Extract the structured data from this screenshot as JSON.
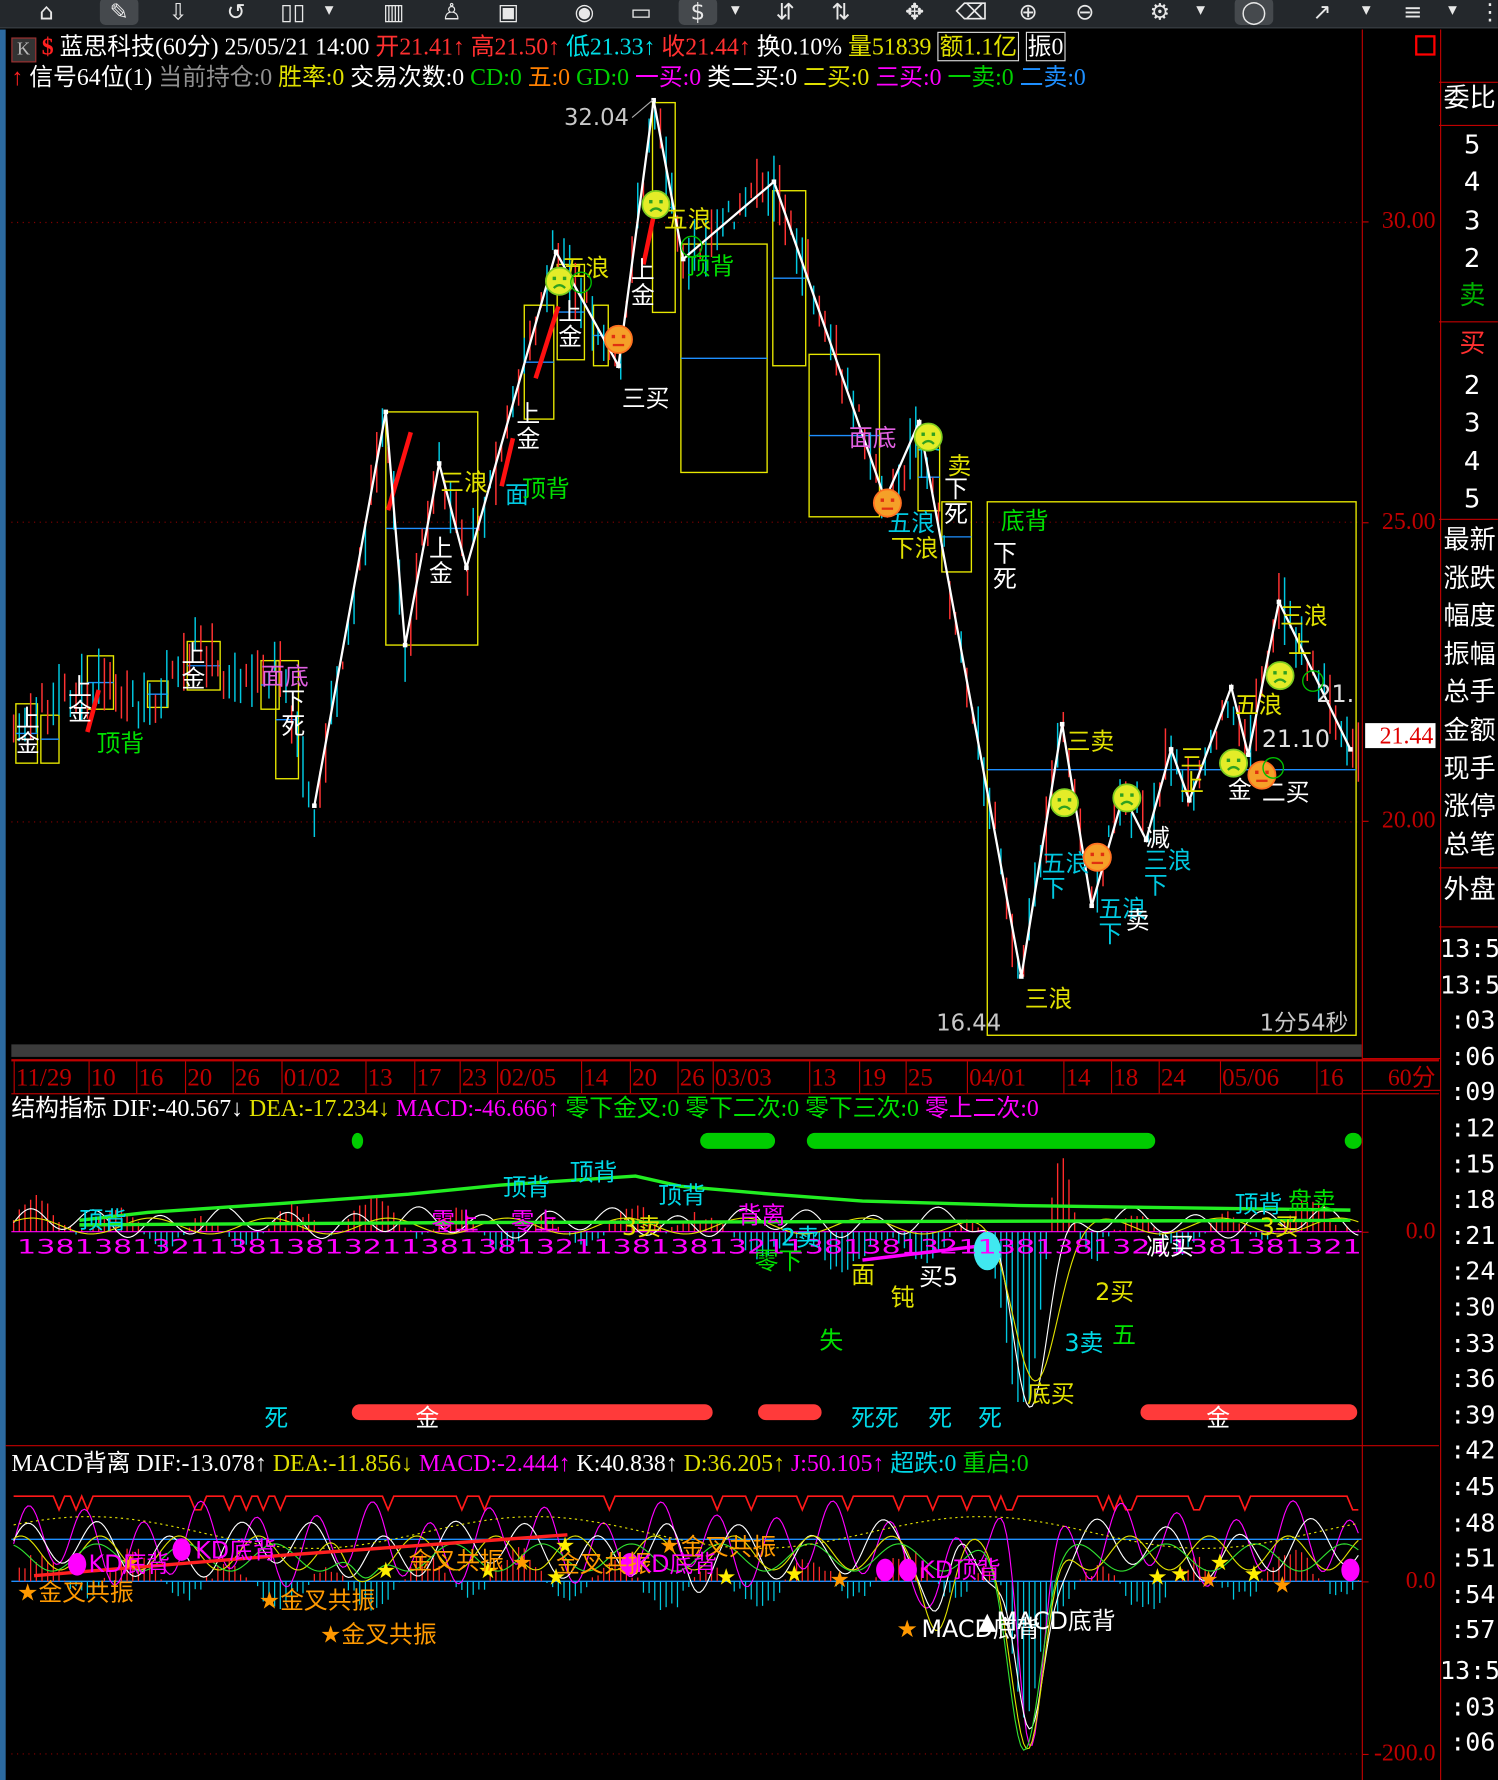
{
  "toolbar": {
    "icons": [
      "home-icon",
      "draw-pen-icon",
      "download-icon",
      "refresh-icon",
      "layout-icon",
      "indicator-icon",
      "alert-bell-icon",
      "screenshot-icon",
      "play-icon",
      "window-icon",
      "dollar-icon",
      "sort-asc-icon",
      "sort-desc-icon",
      "move-icon",
      "eraser-icon",
      "zoom-in-icon",
      "zoom-out-icon",
      "settings-icon",
      "lock-icon",
      "line-tool-icon",
      "percent-icon",
      "more-icon"
    ]
  },
  "header": {
    "k_label": "K",
    "stock": "蓝思科技(60分) 25/05/21 14:00",
    "open": "开21.41",
    "high": "高21.50",
    "low": "低21.33",
    "close": "收21.44",
    "turnover": "换0.10%",
    "volume": "量51839",
    "amount": "额1.1亿",
    "amplitude": "振0",
    "arrow_up": "↑",
    "row2": {
      "signal": "信号64位(1)",
      "position": "当前持仓:0",
      "winrate": "胜率:0",
      "trades": "交易次数:0",
      "cd": "CD:0",
      "wu": "五:0",
      "gd": "GD:0",
      "buy1": "一买:0",
      "class_buy2": "类二买:0",
      "buy2": "二买:0",
      "buy3": "三买:0",
      "sell1": "一卖:0",
      "sell2": "二卖:0"
    }
  },
  "price_axis": {
    "labels": [
      "30.00",
      "25.00",
      "20.00"
    ],
    "current_price": "21.44",
    "ind1_zero": "0.0",
    "ind2_zero": "0.0",
    "ind2_low": "-200.0"
  },
  "date_axis": [
    "11/29",
    "10",
    "16",
    "20",
    "26",
    "01/02",
    "13",
    "17",
    "23",
    "02/05",
    "14",
    "20",
    "26",
    "03/03",
    "13",
    "19",
    "25",
    "04/01",
    "14",
    "18",
    "24",
    "05/06",
    "16"
  ],
  "period": "60分",
  "chart_data": {
    "type": "candlestick",
    "title": "蓝思科技(60分)",
    "ylim": [
      16.44,
      32.04
    ],
    "yticks": [
      30,
      25,
      20
    ],
    "high_label": "32.04",
    "low_label": "16.44",
    "countdown": "1分54秒",
    "price_path": [
      [
        0,
        21.4
      ],
      [
        13.6,
        22.35
      ],
      [
        23.6,
        21.97
      ],
      [
        30.6,
        22.92
      ],
      [
        39.6,
        22.35
      ],
      [
        47.6,
        22.35
      ],
      [
        53,
        20.27
      ],
      [
        65.6,
        26.84
      ],
      [
        69,
        22.95
      ],
      [
        75,
        25.98
      ],
      [
        79.8,
        24.24
      ],
      [
        95.6,
        29.51
      ],
      [
        106.6,
        27.61
      ],
      [
        112.8,
        32.04
      ],
      [
        118,
        29.39
      ],
      [
        134,
        30.68
      ],
      [
        153.6,
        25.38
      ],
      [
        159.6,
        26.67
      ],
      [
        177.6,
        17.42
      ],
      [
        184.8,
        21.63
      ],
      [
        190,
        18.6
      ],
      [
        195.6,
        20.45
      ],
      [
        199.6,
        19.7
      ],
      [
        204,
        21.21
      ],
      [
        207.2,
        20.36
      ],
      [
        214.6,
        22.25
      ],
      [
        217.6,
        21.12
      ],
      [
        223,
        23.67
      ],
      [
        235.6,
        21.21
      ]
    ],
    "structure_line_from": 6,
    "boxes": [
      [
        0.4,
        4.2,
        21.97,
        20.98
      ],
      [
        4.8,
        8,
        21.78,
        20.98
      ],
      [
        13,
        17.6,
        22.77,
        21.88
      ],
      [
        23.6,
        27.2,
        22.35,
        21.91
      ],
      [
        30.6,
        36.4,
        23.01,
        22.2
      ],
      [
        43.6,
        46.8,
        22.69,
        21.88
      ],
      [
        46.2,
        50.2,
        22.69,
        20.72
      ],
      [
        65.6,
        81.8,
        26.84,
        22.95
      ],
      [
        90,
        95.2,
        28.62,
        26.72
      ],
      [
        95.8,
        100.6,
        29.3,
        27.71
      ],
      [
        102.2,
        104.8,
        28.62,
        27.61
      ],
      [
        112.6,
        116.6,
        32.0,
        28.5
      ],
      [
        117.6,
        132.8,
        29.64,
        25.83
      ],
      [
        133.8,
        139.6,
        30.53,
        27.61
      ],
      [
        140.2,
        152.6,
        27.8,
        25.09
      ],
      [
        159.4,
        163.2,
        26.31,
        25.19
      ],
      [
        163.6,
        168.8,
        25.34,
        24.17
      ],
      [
        171.6,
        236.6,
        25.34,
        16.44,
        20.87
      ]
    ],
    "annotations": [
      {
        "t": "上\n金",
        "c": "#ffffff",
        "b": 0.4,
        "p": 21.59
      },
      {
        "t": "上\n金",
        "c": "#ffffff",
        "b": 9.6,
        "p": 22.12
      },
      {
        "t": "顶背",
        "c": "#00e000",
        "b": 14.6,
        "p": 21.17
      },
      {
        "t": "上\n金",
        "c": "#ffffff",
        "b": 29.6,
        "p": 22.67
      },
      {
        "t": "面底",
        "c": "#e060e0",
        "b": 43.6,
        "p": 22.29
      },
      {
        "t": "下\n死",
        "c": "#ffffff",
        "b": 47.2,
        "p": 21.88
      },
      {
        "t": "上\n金",
        "c": "#ffffff",
        "b": 73.2,
        "p": 24.43
      },
      {
        "t": "三浪",
        "c": "#e0e000",
        "b": 75.2,
        "p": 25.53
      },
      {
        "t": "面",
        "c": "#00c8e0",
        "b": 86.6,
        "p": 25.32
      },
      {
        "t": "顶背",
        "c": "#00e000",
        "b": 89.6,
        "p": 25.42
      },
      {
        "t": "上\n金",
        "c": "#ffffff",
        "b": 88.6,
        "p": 26.67
      },
      {
        "t": "上\n金",
        "c": "#ffffff",
        "b": 96,
        "p": 28.37
      },
      {
        "t": "五浪",
        "c": "#e0e000",
        "b": 96.6,
        "p": 29.11
      },
      {
        "t": "三买",
        "c": "#ffffff",
        "b": 107.2,
        "p": 26.93
      },
      {
        "t": "上\n金",
        "c": "#ffffff",
        "b": 108.8,
        "p": 29.07
      },
      {
        "t": "五浪",
        "c": "#e0e000",
        "b": 114.6,
        "p": 29.92
      },
      {
        "t": "顶背",
        "c": "#00e000",
        "b": 118.6,
        "p": 29.13
      },
      {
        "t": "面底",
        "c": "#e060e0",
        "b": 147.2,
        "p": 26.27
      },
      {
        "t": "类",
        "c": "#00c8e0",
        "b": 159.2,
        "p": 26.23
      },
      {
        "t": "卖",
        "c": "#e0e000",
        "b": 164.6,
        "p": 25.8
      },
      {
        "t": "下\n死",
        "c": "#ffffff",
        "b": 164,
        "p": 25.42
      },
      {
        "t": "五浪",
        "c": "#00c8e0",
        "b": 154,
        "p": 24.85
      },
      {
        "t": "下浪",
        "c": "#e0e000",
        "b": 154.6,
        "p": 24.43
      },
      {
        "t": "底背",
        "c": "#00e000",
        "b": 174,
        "p": 24.89
      },
      {
        "t": "下\n死",
        "c": "#ffffff",
        "b": 172.6,
        "p": 24.34
      },
      {
        "t": "三卖",
        "c": "#e0e000",
        "b": 185.6,
        "p": 21.21
      },
      {
        "t": "五浪\n下",
        "c": "#00c8e0",
        "b": 181.2,
        "p": 19.17
      },
      {
        "t": "五浪\n下",
        "c": "#00c8e0",
        "b": 191.2,
        "p": 18.41
      },
      {
        "t": "卖",
        "c": "#ffffff",
        "b": 196,
        "p": 18.22
      },
      {
        "t": "三浪",
        "c": "#e0e000",
        "b": 178.2,
        "p": 16.91
      },
      {
        "t": "减",
        "c": "#ffffff",
        "b": 199.6,
        "p": 19.6
      },
      {
        "t": "三浪\n下",
        "c": "#00c8e0",
        "b": 199.2,
        "p": 19.22
      },
      {
        "t": "三\n上",
        "c": "#e0e000",
        "b": 205.6,
        "p": 20.93
      },
      {
        "t": "五浪",
        "c": "#e0e000",
        "b": 215.2,
        "p": 21.82
      },
      {
        "t": "21.10",
        "c": "#e0e0e0",
        "b": 220,
        "p": 21.25
      },
      {
        "t": "21.",
        "c": "#e0e0e0",
        "b": 229.6,
        "p": 22.0
      },
      {
        "t": "二买",
        "c": "#ffffff",
        "b": 220,
        "p": 20.36
      },
      {
        "t": "金",
        "c": "#ffffff",
        "b": 214,
        "p": 20.4
      },
      {
        "t": "三浪",
        "c": "#e0e000",
        "b": 223.2,
        "p": 23.3
      },
      {
        "t": "上",
        "c": "#e0e000",
        "b": 224.6,
        "p": 22.82
      }
    ],
    "smileys": [
      {
        "b": 113.2,
        "p": 30.3,
        "m": "sad"
      },
      {
        "b": 96.2,
        "p": 29.02,
        "m": "sad"
      },
      {
        "b": 106.6,
        "p": 28.05,
        "m": "neutral"
      },
      {
        "b": 161.2,
        "p": 26.42,
        "m": "sad"
      },
      {
        "b": 154,
        "p": 25.32,
        "m": "neutral"
      },
      {
        "b": 185.2,
        "p": 20.32,
        "m": "sad"
      },
      {
        "b": 191,
        "p": 19.41,
        "m": "neutral"
      },
      {
        "b": 196.2,
        "p": 20.4,
        "m": "sad"
      },
      {
        "b": 215,
        "p": 20.98,
        "m": "sad"
      },
      {
        "b": 220,
        "p": 20.78,
        "m": "neutral"
      },
      {
        "b": 223.2,
        "p": 22.44,
        "m": "sad"
      }
    ]
  },
  "ind1": {
    "name": "结构指标",
    "dif": "DIF:-40.567",
    "dea": "DEA:-17.234",
    "macd": "MACD:-46.666",
    "zero_gold": "零下金叉:0",
    "zero_second": "零下二次:0",
    "zero_third": "零下三次:0",
    "above_second": "零上二次:0",
    "arrow_down": "↓",
    "arrow_up": "↑",
    "number_strip": "1381381321138138132113813813211381381321138138132113813813211381381321",
    "labels": [
      {
        "t": "死",
        "c": "#00d8e8"
      },
      {
        "t": "金",
        "c": "#ffffff"
      },
      {
        "t": "死死",
        "c": "#00d8e8"
      },
      {
        "t": "死",
        "c": "#00d8e8"
      },
      {
        "t": "死",
        "c": "#00d8e8"
      },
      {
        "t": "金",
        "c": "#ffffff"
      },
      {
        "t": "顶背",
        "c": "#00d8e8"
      },
      {
        "t": "顶背",
        "c": "#00d8e8"
      },
      {
        "t": "顶背",
        "c": "#00d8e8"
      },
      {
        "t": "顶背",
        "c": "#00d8e8"
      },
      {
        "t": "顶背",
        "c": "#00d8e8"
      },
      {
        "t": "失",
        "c": "#00e000"
      },
      {
        "t": "2买",
        "c": "#e0e000"
      },
      {
        "t": "3卖",
        "c": "#00d8e8"
      },
      {
        "t": "五",
        "c": "#00e000"
      },
      {
        "t": "底买",
        "c": "#e0e000"
      },
      {
        "t": "钝",
        "c": "#e0e000"
      },
      {
        "t": "面",
        "c": "#e0e000"
      },
      {
        "t": "2卖",
        "c": "#00d8e8"
      },
      {
        "t": "零下",
        "c": "#00e000"
      },
      {
        "t": "买5",
        "c": "#ffffff"
      },
      {
        "t": "盘卖",
        "c": "#00e000"
      },
      {
        "t": "3买",
        "c": "#e0e000"
      },
      {
        "t": "减买",
        "c": "#ffffff"
      },
      {
        "t": "零上",
        "c": "#ff00ff"
      },
      {
        "t": "零上",
        "c": "#ff00ff"
      },
      {
        "t": "3卖",
        "c": "#e0e000"
      },
      {
        "t": "背离",
        "c": "#ff00ff"
      }
    ]
  },
  "ind2": {
    "name": "MACD背离",
    "dif": "DIF:-13.078",
    "dea": "DEA:-11.856",
    "macd": "MACD:-2.444",
    "k": "K:40.838",
    "d": "D:36.205",
    "j": "J:50.105",
    "oversold": "超跌:0",
    "restart": "重启:0",
    "arrow_down": "↓",
    "arrow_up": "↑",
    "labels": [
      {
        "t": "★金叉共振",
        "c": "#ff9900"
      },
      {
        "t": "★金叉共振",
        "c": "#ff9900"
      },
      {
        "t": "★金叉共振",
        "c": "#ff9900"
      },
      {
        "t": "金叉共振",
        "c": "#ff9900"
      },
      {
        "t": "金叉共振",
        "c": "#ff9900"
      },
      {
        "t": "金叉共振",
        "c": "#ff9900"
      },
      {
        "t": "★",
        "c": "#ff9900"
      },
      {
        "t": "MACD底背",
        "c": "#ffffff"
      },
      {
        "t": "▲MACD底背",
        "c": "#ffffff"
      },
      {
        "t": "KD底背",
        "c": "#ff00ff"
      },
      {
        "t": "KD底背",
        "c": "#ff00ff"
      },
      {
        "t": "KD底背",
        "c": "#ff00ff"
      },
      {
        "t": "KD顶背",
        "c": "#ff00ff"
      }
    ]
  },
  "right_panel": {
    "weibi": "委比",
    "sell_levels": [
      "5",
      "4",
      "3",
      "2"
    ],
    "sell": "卖",
    "buy": "买",
    "buy_levels": [
      "2",
      "3",
      "4",
      "5"
    ],
    "fields": [
      "最新",
      "涨跌",
      "幅度",
      "振幅",
      "总手",
      "金额",
      "现手",
      "涨停",
      "总笔"
    ],
    "outer": "外盘",
    "times": [
      "13:56",
      "13:57",
      ":03",
      ":06",
      ":09",
      ":12",
      ":15",
      ":18",
      ":21",
      ":24",
      ":30",
      ":33",
      ":36",
      ":39",
      ":42",
      ":45",
      ":48",
      ":51",
      ":54",
      ":57",
      "13:58",
      ":03",
      ":06"
    ]
  },
  "colors": {
    "up": "#ff3232",
    "down": "#00c8e0",
    "axis": "#c00000",
    "box": "#e8e800",
    "structure": "#ffffff"
  }
}
